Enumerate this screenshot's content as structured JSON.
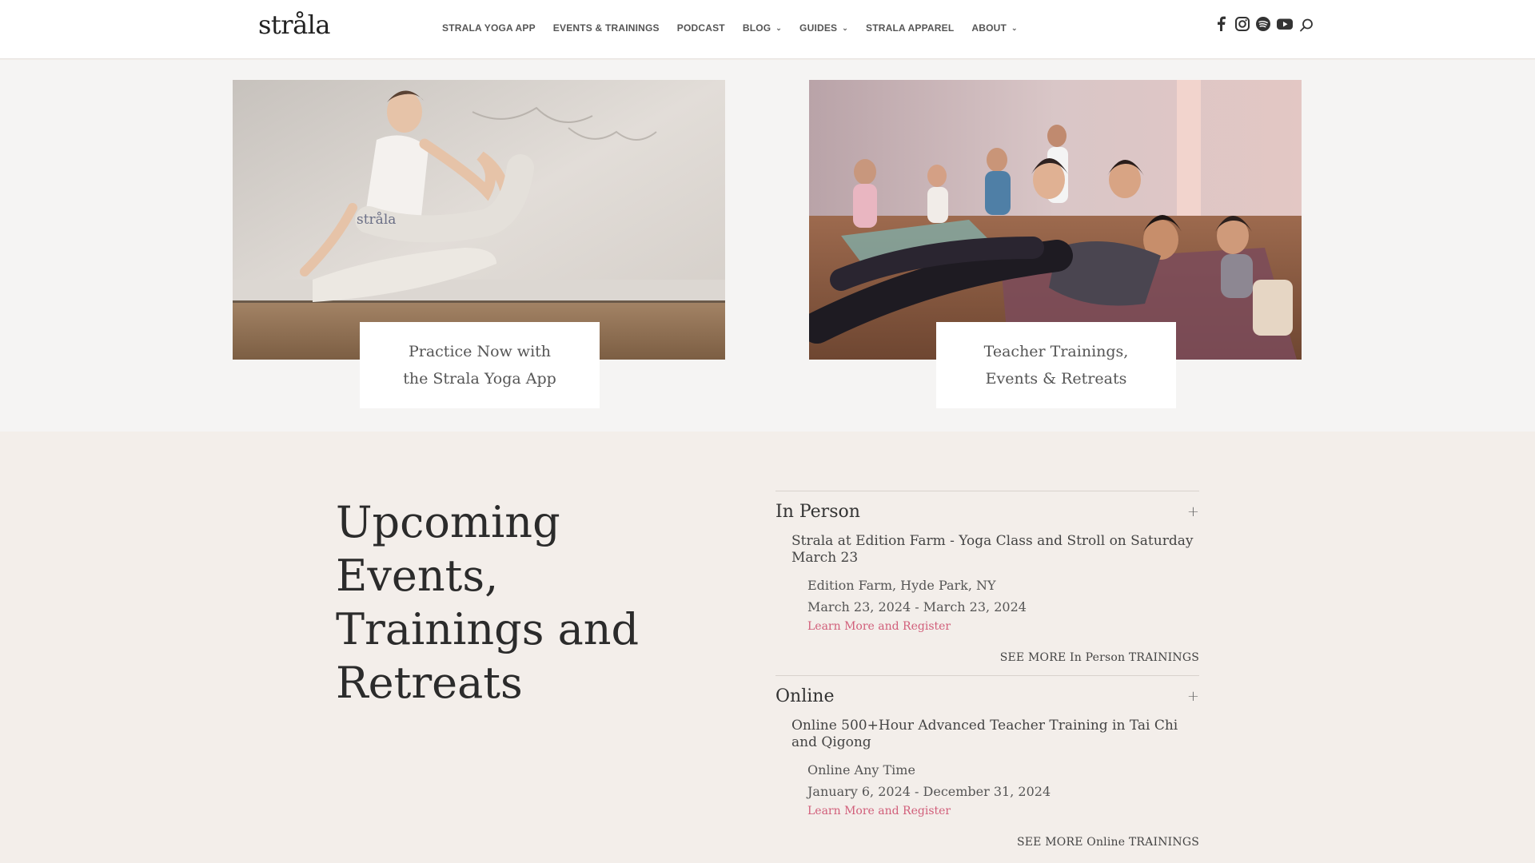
{
  "header": {
    "logo": "stråla",
    "nav": [
      {
        "label": "STRALA YOGA APP",
        "dropdown": false
      },
      {
        "label": "EVENTS & TRAININGS",
        "dropdown": false
      },
      {
        "label": "PODCAST",
        "dropdown": false
      },
      {
        "label": "BLOG",
        "dropdown": true
      },
      {
        "label": "GUIDES",
        "dropdown": true
      },
      {
        "label": "STRALA APPAREL",
        "dropdown": false
      },
      {
        "label": "ABOUT",
        "dropdown": true
      }
    ],
    "social_icons": [
      "facebook-icon",
      "instagram-icon",
      "spotify-icon",
      "youtube-icon"
    ],
    "search_icon": "search-icon"
  },
  "features": [
    {
      "caption_line1": "Practice Now with",
      "caption_line2": "the Strala Yoga App"
    },
    {
      "caption_line1": "Teacher Trainings,",
      "caption_line2": "Events & Retreats"
    }
  ],
  "events": {
    "title_line1": "Upcoming Events,",
    "title_line2": "Trainings and",
    "title_line3": "Retreats",
    "sections": [
      {
        "heading": "In Person",
        "event_title": "Strala at Edition Farm - Yoga Class and Stroll on Saturday March 23",
        "location": "Edition Farm, Hyde Park, NY",
        "dates": "March 23, 2024 - March 23, 2024",
        "link": "Learn More and Register",
        "see_more": "SEE MORE In Person TRAININGS"
      },
      {
        "heading": "Online",
        "event_title": "Online 500+Hour Advanced Teacher Training in Tai Chi and Qigong",
        "location": "Online Any Time",
        "dates": "January 6, 2024 - December 31, 2024",
        "link": "Learn More and Register",
        "see_more": "SEE MORE Online TRAININGS"
      }
    ]
  },
  "colors": {
    "accent_link": "#d15e7a",
    "header_bg": "#ffffff",
    "band_bg": "#f5f4f3",
    "events_bg": "#f3eeea"
  }
}
